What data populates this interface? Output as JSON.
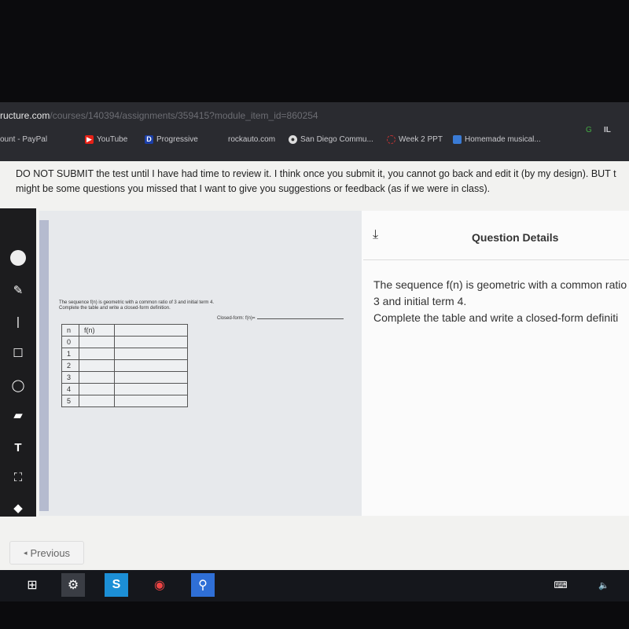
{
  "browser": {
    "url_host": "ructure.com",
    "url_path": "/courses/140394/assignments/359415?module_item_id=860254",
    "bookmarks": [
      {
        "label": "ount - PayPal",
        "icon": "paypal-icon",
        "color": "#2a2b30"
      },
      {
        "label": "YouTube",
        "icon": "youtube-icon",
        "color": "#e62117"
      },
      {
        "label": "Progressive",
        "icon": "progressive-icon",
        "color": "#1b3fa8"
      },
      {
        "label": "rockauto.com",
        "icon": "",
        "color": "#2a2b30"
      },
      {
        "label": "San Diego Commu...",
        "icon": "globe-icon",
        "color": "#ddd"
      },
      {
        "label": "Week 2 PPT",
        "icon": "loading-icon",
        "color": "#b33"
      },
      {
        "label": "Homemade musical...",
        "icon": "site-icon",
        "color": "#3a7bd5"
      }
    ],
    "ext": [
      "G",
      "IL"
    ]
  },
  "banner": {
    "line1": "DO NOT SUBMIT the test until I have had time to review it. I think once you submit it, you cannot go back and edit it (by my design). BUT t",
    "line2": "might be some questions you missed that I want to give you suggestions or feedback (as if we were in class)."
  },
  "toolbar": [
    "pointer-tool",
    "pen-tool",
    "divider",
    "rectangle-tool",
    "circle-tool",
    "image-tool",
    "text-tool",
    "crop-tool",
    "eraser-tool"
  ],
  "worksheet": {
    "line1": "The sequence f(n) is geometric with a common ratio of 3 and initial term 4.",
    "line2": "Complete the table and write a closed-form definition.",
    "closed_form_label": "Closed-form: f(n)=",
    "headers": [
      "n",
      "f(n)",
      ""
    ],
    "rows": [
      "0",
      "1",
      "2",
      "3",
      "4",
      "5"
    ]
  },
  "panel": {
    "title": "Question Details",
    "line1": "The sequence f(n) is geometric with a common ratio of",
    "line2": "3 and initial term 4.",
    "line3": "Complete the table and write a closed-form definiti"
  },
  "nav": {
    "previous": "Previous"
  }
}
